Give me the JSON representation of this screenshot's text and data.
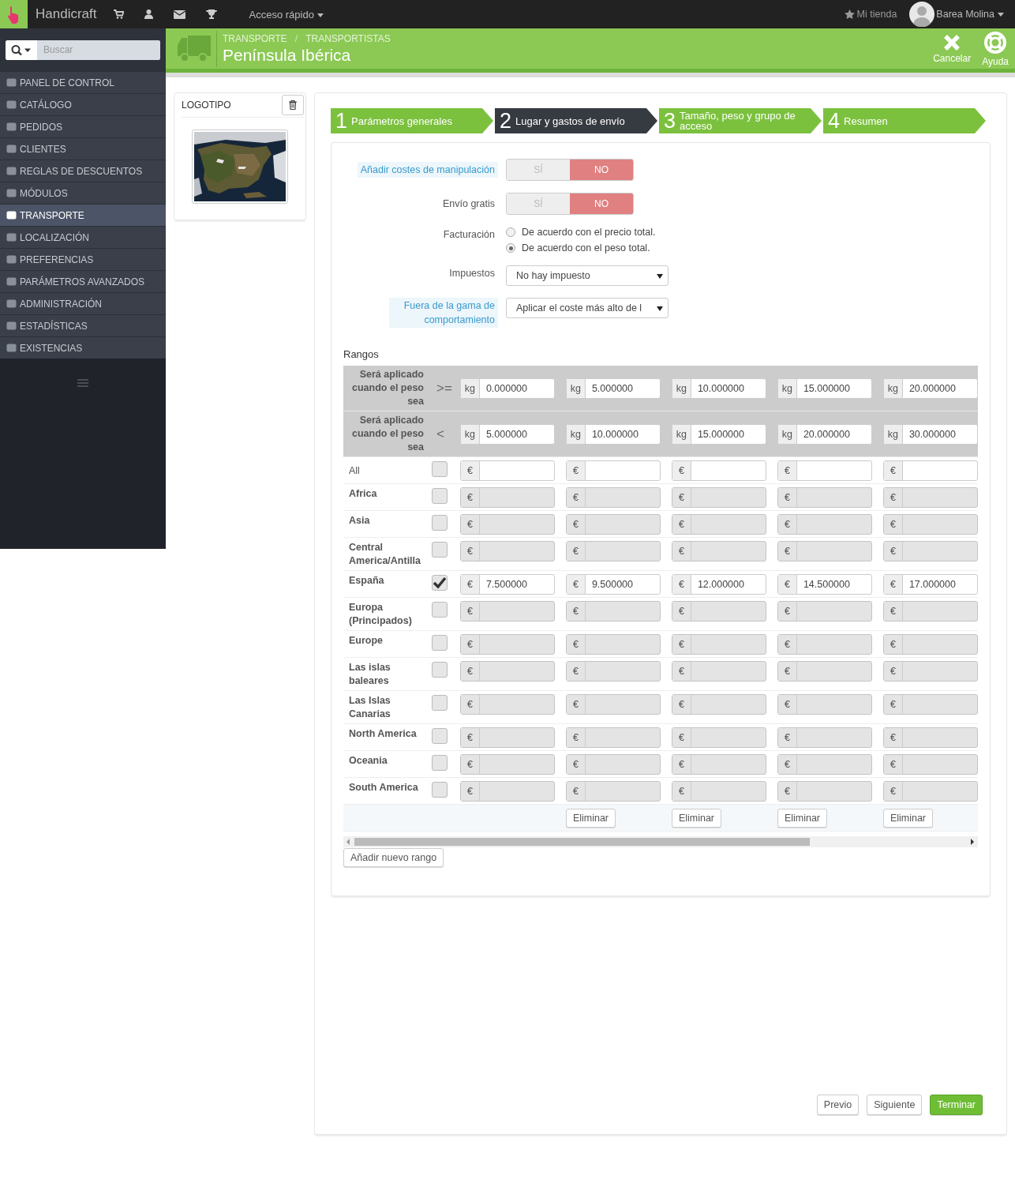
{
  "topbar": {
    "brand": "Handicraft",
    "quick_access": "Acceso rápido",
    "shop": "Mi tienda",
    "user": "Barea Molina"
  },
  "search": {
    "placeholder": "Buscar"
  },
  "sidebar": {
    "items": [
      {
        "label": "PANEL DE CONTROL",
        "selected": false
      },
      {
        "label": "CATÁLOGO",
        "selected": false
      },
      {
        "label": "PEDIDOS",
        "selected": false
      },
      {
        "label": "CLIENTES",
        "selected": false
      },
      {
        "label": "REGLAS DE DESCUENTOS",
        "selected": false
      },
      {
        "label": "MÓDULOS",
        "selected": false
      },
      {
        "label": "TRANSPORTE",
        "selected": true
      },
      {
        "label": "LOCALIZACIÓN",
        "selected": false
      },
      {
        "label": "PREFERENCIAS",
        "selected": false
      },
      {
        "label": "PARÁMETROS AVANZADOS",
        "selected": false
      },
      {
        "label": "ADMINISTRACIÓN",
        "selected": false
      },
      {
        "label": "ESTADÍSTICAS",
        "selected": false
      },
      {
        "label": "EXISTENCIAS",
        "selected": false
      }
    ]
  },
  "header": {
    "breadcrumb": [
      "TRANSPORTE",
      "TRANSPORTISTAS"
    ],
    "breadcrumb_separator": "/",
    "title": "Península Ibérica",
    "actions": [
      {
        "label": "Cancelar",
        "kind": "cancel"
      },
      {
        "label": "Ayuda",
        "kind": "help"
      }
    ]
  },
  "logo_panel": {
    "title": "LOGOTIPO"
  },
  "steps": [
    {
      "number": "1",
      "label": "Parámetros generales",
      "selected": false
    },
    {
      "number": "2",
      "label": "Lugar y gastos de envío",
      "selected": true
    },
    {
      "number": "3",
      "label": "Tamaño, peso y grupo de acceso",
      "selected": false
    },
    {
      "number": "4",
      "label": "Resumen",
      "selected": false
    }
  ],
  "form": {
    "toggles": [
      {
        "label": "Añadir costes de manipulación",
        "help": true,
        "yes": "SÍ",
        "no": "NO",
        "on": false
      },
      {
        "label": "Envío gratis",
        "help": false,
        "yes": "SÍ",
        "no": "NO",
        "on": false
      }
    ],
    "billing": {
      "label": "Facturación",
      "options": [
        {
          "label": "De acuerdo con el precio total.",
          "selected": false
        },
        {
          "label": "De acuerdo con el peso total.",
          "selected": true
        }
      ]
    },
    "selects": [
      {
        "label": "Impuestos",
        "help": false,
        "value": "No hay impuesto"
      },
      {
        "label": "Fuera de la gama de comportamiento",
        "help": true,
        "value": "Aplicar el coste más alto de l"
      }
    ]
  },
  "ranges": {
    "title": "Rangos",
    "bounds": [
      {
        "label": "Será aplicado cuando el peso sea",
        "operator": ">="
      },
      {
        "label": "Será aplicado cuando el peso sea",
        "operator": "<"
      }
    ],
    "columns": [
      {
        "from_unit": "kg",
        "from": "0.000000",
        "to_unit": "kg",
        "to": "5.000000"
      },
      {
        "from_unit": "kg",
        "from": "5.000000",
        "to_unit": "kg",
        "to": "10.000000",
        "delete": "Eliminar"
      },
      {
        "from_unit": "kg",
        "from": "10.000000",
        "to_unit": "kg",
        "to": "15.000000",
        "delete": "Eliminar"
      },
      {
        "from_unit": "kg",
        "from": "15.000000",
        "to_unit": "kg",
        "to": "20.000000",
        "delete": "Eliminar"
      },
      {
        "from_unit": "kg",
        "from": "20.000000",
        "to_unit": "kg",
        "to": "30.000000",
        "delete": "Eliminar"
      }
    ],
    "zones": [
      {
        "name": "All",
        "kind": "all",
        "checked": false,
        "disabled": false,
        "cells": [
          {
            "currency": "€"
          },
          {
            "currency": "€"
          },
          {
            "currency": "€"
          },
          {
            "currency": "€"
          },
          {
            "currency": "€"
          }
        ]
      },
      {
        "name": "Africa",
        "kind": "zone",
        "checked": false,
        "disabled": true,
        "cells": [
          {
            "currency": "€"
          },
          {
            "currency": "€"
          },
          {
            "currency": "€"
          },
          {
            "currency": "€"
          },
          {
            "currency": "€"
          }
        ]
      },
      {
        "name": "Asia",
        "kind": "zone",
        "checked": false,
        "disabled": true,
        "cells": [
          {
            "currency": "€"
          },
          {
            "currency": "€"
          },
          {
            "currency": "€"
          },
          {
            "currency": "€"
          },
          {
            "currency": "€"
          }
        ]
      },
      {
        "name": "Central America/Antilla",
        "kind": "zone",
        "checked": false,
        "disabled": true,
        "cells": [
          {
            "currency": "€"
          },
          {
            "currency": "€"
          },
          {
            "currency": "€"
          },
          {
            "currency": "€"
          },
          {
            "currency": "€"
          }
        ]
      },
      {
        "name": "España",
        "kind": "zone",
        "checked": true,
        "disabled": false,
        "cells": [
          {
            "currency": "€",
            "value": "7.500000"
          },
          {
            "currency": "€",
            "value": "9.500000"
          },
          {
            "currency": "€",
            "value": "12.000000"
          },
          {
            "currency": "€",
            "value": "14.500000"
          },
          {
            "currency": "€",
            "value": "17.000000"
          }
        ]
      },
      {
        "name": "Europa (Principados)",
        "kind": "zone",
        "checked": false,
        "disabled": true,
        "cells": [
          {
            "currency": "€"
          },
          {
            "currency": "€"
          },
          {
            "currency": "€"
          },
          {
            "currency": "€"
          },
          {
            "currency": "€"
          }
        ]
      },
      {
        "name": "Europe",
        "kind": "zone",
        "checked": false,
        "disabled": true,
        "cells": [
          {
            "currency": "€"
          },
          {
            "currency": "€"
          },
          {
            "currency": "€"
          },
          {
            "currency": "€"
          },
          {
            "currency": "€"
          }
        ]
      },
      {
        "name": "Las islas baleares",
        "kind": "zone",
        "checked": false,
        "disabled": true,
        "cells": [
          {
            "currency": "€"
          },
          {
            "currency": "€"
          },
          {
            "currency": "€"
          },
          {
            "currency": "€"
          },
          {
            "currency": "€"
          }
        ]
      },
      {
        "name": "Las Islas Canarias",
        "kind": "zone",
        "checked": false,
        "disabled": true,
        "cells": [
          {
            "currency": "€"
          },
          {
            "currency": "€"
          },
          {
            "currency": "€"
          },
          {
            "currency": "€"
          },
          {
            "currency": "€"
          }
        ]
      },
      {
        "name": "North America",
        "kind": "zone",
        "checked": false,
        "disabled": true,
        "cells": [
          {
            "currency": "€"
          },
          {
            "currency": "€"
          },
          {
            "currency": "€"
          },
          {
            "currency": "€"
          },
          {
            "currency": "€"
          }
        ]
      },
      {
        "name": "Oceania",
        "kind": "zone",
        "checked": false,
        "disabled": true,
        "cells": [
          {
            "currency": "€"
          },
          {
            "currency": "€"
          },
          {
            "currency": "€"
          },
          {
            "currency": "€"
          },
          {
            "currency": "€"
          }
        ]
      },
      {
        "name": "South America",
        "kind": "zone",
        "checked": false,
        "disabled": true,
        "cells": [
          {
            "currency": "€"
          },
          {
            "currency": "€"
          },
          {
            "currency": "€"
          },
          {
            "currency": "€"
          },
          {
            "currency": "€"
          }
        ]
      }
    ],
    "add_button": "Añadir nuevo rango"
  },
  "footer": {
    "buttons": [
      {
        "label": "Previo",
        "kind": "default"
      },
      {
        "label": "Siguiente",
        "kind": "default"
      },
      {
        "label": "Terminar",
        "kind": "primary"
      }
    ]
  }
}
